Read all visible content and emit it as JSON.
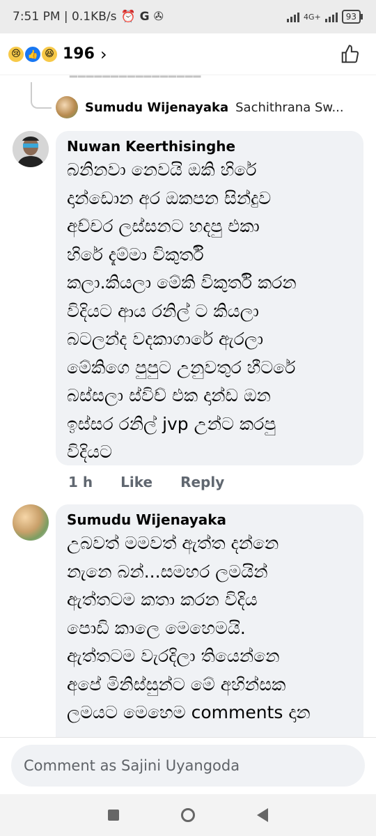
{
  "status": {
    "time_speed": "7:51 PM | 0.1KB/s",
    "network": "4G+",
    "battery": "93"
  },
  "reactions": {
    "count": "196",
    "chevron": "›"
  },
  "preview": {
    "name": "Sumudu Wijenayaka",
    "text": "Sachithrana Sw..."
  },
  "comments": [
    {
      "name": "Nuwan Keerthisinghe",
      "text": "බනිනවා නෙවයි ඔකි හිරේ\nදාන්ඩොන අර ඔකපන සින්දුව\nඅච්චර ලස්සනට හදපු එකා\nහිරේ දැම්මා විකුර්ති\nකලා.කියලා මේකි විකුර්ති කරන\nවිදියට ආය රනිල් ට කියලා\nබටලන්ද වදකාගාරේ ඇරලා\nමේකිගෙ පුපුට උනුවතුර හීටරේ\nබස්සලා ස්විච් එක දාන්ඩ ඔන\nඉස්සර රනිල් jvp උන්ට කරපු\nවිදියට",
      "time": "1 h",
      "like": "Like",
      "reply": "Reply"
    },
    {
      "name": "Sumudu Wijenayaka",
      "text": "උබවත් මමවත් ඇත්ත දන්නෙ\nනැනෙ බන්...සමහර ලමයින්\nඇත්තටම කතා කරන විදිය\nපොඩි කාලෙ මෙහෙමයි.\nඇත්තටම වැරදිලා තියෙන්නෙ\nඅපේ මිනිස්සුන්ට මේ අහින්සක\nලමයට මෙහෙම comments දාන"
    }
  ],
  "composer": {
    "placeholder": "Comment as Sajini Uyangoda"
  }
}
